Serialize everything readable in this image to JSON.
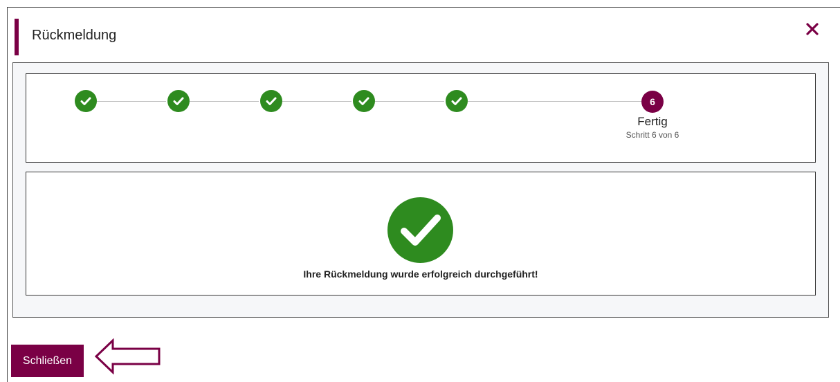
{
  "dialog": {
    "title": "Rückmeldung",
    "close_icon": "close-icon"
  },
  "stepper": {
    "completed_steps": 5,
    "total_steps": 6,
    "current_step_number": "6",
    "current_step_label": "Fertig",
    "current_step_sub": "Schritt 6 von 6",
    "done_icon": "checkmark-icon"
  },
  "result": {
    "icon": "success-check-icon",
    "message": "Ihre Rückmeldung wurde erfolgreich durchgeführt!"
  },
  "footer": {
    "close_button_label": "Schließen",
    "annotation_icon": "left-arrow-icon"
  },
  "colors": {
    "accent": "#7a0045",
    "success": "#2e8b1f"
  }
}
